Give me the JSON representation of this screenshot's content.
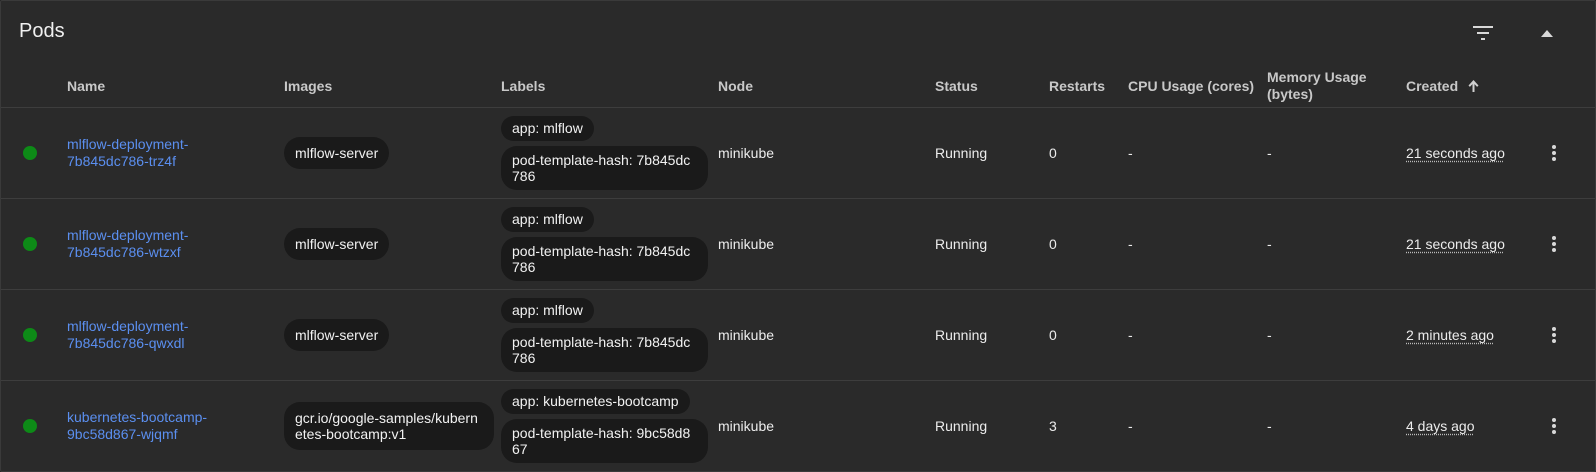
{
  "card": {
    "title": "Pods",
    "filter_icon": "filter-list-icon",
    "collapse_icon": "arrow-drop-up-icon"
  },
  "columns": {
    "name": "Name",
    "images": "Images",
    "labels": "Labels",
    "node": "Node",
    "status": "Status",
    "restarts": "Restarts",
    "cpu": "CPU Usage (cores)",
    "memory": "Memory Usage (bytes)",
    "created": "Created",
    "created_sort_icon": "arrow-upward-icon"
  },
  "colors": {
    "running": "#0d8a17",
    "link": "#5b8ff0"
  },
  "pods": [
    {
      "status_icon": "running-status-dot",
      "name": "mlflow-deployment-7b845dc786-trz4f",
      "image": "mlflow-server",
      "label_app": "app: mlflow",
      "label_hash": "pod-template-hash: 7b845dc786",
      "node": "minikube",
      "status": "Running",
      "restarts": "0",
      "cpu": "-",
      "memory": "-",
      "created": "21 seconds ago"
    },
    {
      "status_icon": "running-status-dot",
      "name": "mlflow-deployment-7b845dc786-wtzxf",
      "image": "mlflow-server",
      "label_app": "app: mlflow",
      "label_hash": "pod-template-hash: 7b845dc786",
      "node": "minikube",
      "status": "Running",
      "restarts": "0",
      "cpu": "-",
      "memory": "-",
      "created": "21 seconds ago"
    },
    {
      "status_icon": "running-status-dot",
      "name": "mlflow-deployment-7b845dc786-qwxdl",
      "image": "mlflow-server",
      "label_app": "app: mlflow",
      "label_hash": "pod-template-hash: 7b845dc786",
      "node": "minikube",
      "status": "Running",
      "restarts": "0",
      "cpu": "-",
      "memory": "-",
      "created": "2 minutes ago"
    },
    {
      "status_icon": "running-status-dot",
      "name": "kubernetes-bootcamp-9bc58d867-wjqmf",
      "image": "gcr.io/google-samples/kubernetes-bootcamp:v1",
      "label_app": "app: kubernetes-bootcamp",
      "label_hash": "pod-template-hash: 9bc58d867",
      "node": "minikube",
      "status": "Running",
      "restarts": "3",
      "cpu": "-",
      "memory": "-",
      "created": "4 days ago"
    }
  ]
}
